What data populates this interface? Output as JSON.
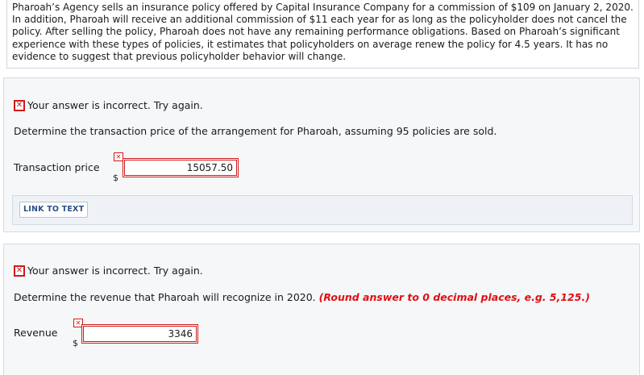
{
  "problem": {
    "text": "Pharoah’s Agency sells an insurance policy offered by Capital Insurance Company for a commission of $109 on January 2, 2020. In addition, Pharoah will receive an additional commission of $11 each year for as long as the policyholder does not cancel the policy. After selling the policy, Pharoah does not have any remaining performance obligations. Based on Pharoah’s significant experience with these types of policies, it estimates that policyholders on average renew the policy for 4.5 years. It has no evidence to suggest that previous policyholder behavior will change."
  },
  "part1": {
    "status": "Your answer is incorrect.  Try again.",
    "question": "Determine the transaction price of the arrangement for Pharoah, assuming 95 policies are sold.",
    "field_label": "Transaction price",
    "currency": "$",
    "answer": "15057.50",
    "link_label": "LINK TO TEXT"
  },
  "part2": {
    "status": "Your answer is incorrect.  Try again.",
    "question": "Determine the revenue that Pharoah will recognize in 2020.",
    "hint": "(Round answer to 0 decimal places, e.g. 5,125.)",
    "field_label": "Revenue",
    "currency": "$",
    "answer": "3346"
  },
  "icons": {
    "incorrect": "x-mark-icon"
  },
  "colors": {
    "error": "#d21919",
    "hint": "#e01010",
    "link": "#2a4f86"
  }
}
